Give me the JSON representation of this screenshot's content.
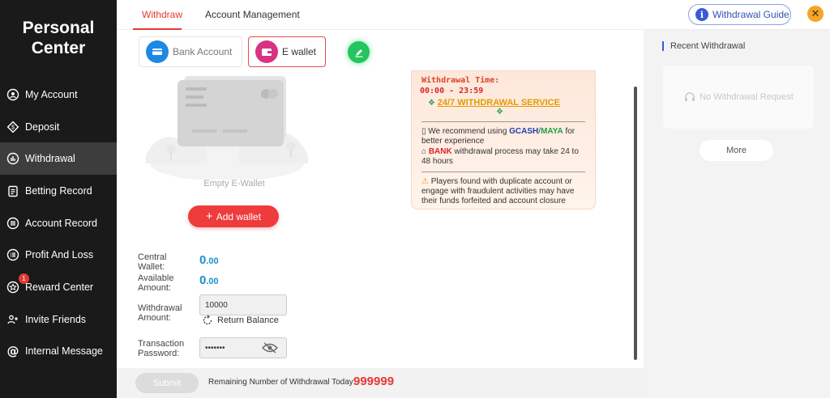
{
  "sidebar": {
    "title_line1": "Personal",
    "title_line2": "Center",
    "items": [
      {
        "label": "My Account",
        "icon": "user-circle-icon"
      },
      {
        "label": "Deposit",
        "icon": "diamond-icon"
      },
      {
        "label": "Withdrawal",
        "icon": "bar-chart-icon",
        "active": true
      },
      {
        "label": "Betting Record",
        "icon": "clipboard-icon"
      },
      {
        "label": "Account Record",
        "icon": "list-circle-icon"
      },
      {
        "label": "Profit And Loss",
        "icon": "list-lines-icon"
      },
      {
        "label": "Reward Center",
        "icon": "star-circle-icon",
        "badge": "1"
      },
      {
        "label": "Invite Friends",
        "icon": "users-plus-icon"
      },
      {
        "label": "Internal Message",
        "icon": "at-icon"
      }
    ]
  },
  "tabs": {
    "withdraw": "Withdraw",
    "account_management": "Account Management"
  },
  "guide_label": "Withdrawal Guide",
  "methods": {
    "bank": "Bank Account",
    "ewallet": "E wallet"
  },
  "empty_label": "Empty E-Wallet",
  "add_wallet_label": "Add wallet",
  "notice": {
    "title": "Withdrawal Time:",
    "time": "00:00 - 23:59",
    "service": "24/7 WITHDRAWAL SERVICE",
    "rec_prefix": "We recommend using ",
    "gcash": "GCASH",
    "slash": "/",
    "maya": "MAYA",
    "rec_suffix": " for better experience",
    "bank": "BANK",
    "bank_suffix": " withdrawal process may take 24 to 48 hours",
    "warning": "Players found with duplicate account or engage with fraudulent activities may have their funds forfeited and account closure"
  },
  "form": {
    "central_wallet_label": "Central Wallet:",
    "central_wallet_value": "0",
    "central_wallet_decimals": ".00",
    "available_label": "Available Amount:",
    "available_value": "0",
    "available_decimals": ".00",
    "withdrawal_label": "Withdrawal Amount:",
    "withdrawal_value": "10000",
    "return_balance_label": "Return Balance",
    "password_label": "Transaction Password:",
    "password_value": "•••••••"
  },
  "submit_label": "Submit",
  "remaining_label": "Remaining Number of Withdrawal Today:",
  "remaining_value": "999999",
  "right_panel": {
    "title": "Recent Withdrawal",
    "empty": "No Withdrawal Request",
    "more": "More"
  },
  "colors": {
    "accent": "#e53935",
    "sidebar_bg": "#1a1a1a",
    "link_blue": "#1d8fcb"
  }
}
